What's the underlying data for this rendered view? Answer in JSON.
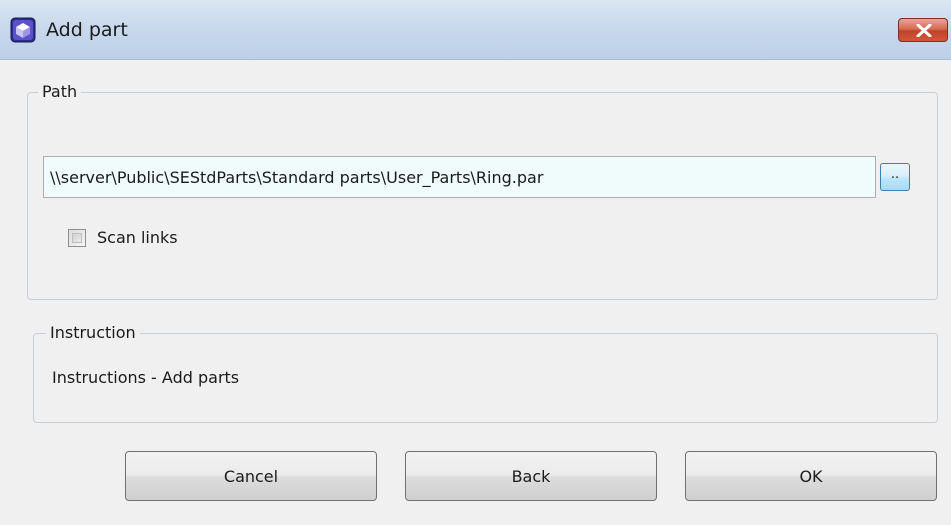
{
  "window": {
    "title": "Add part",
    "app_icon": "solid-edge-app-icon",
    "close_icon": "close-icon"
  },
  "path_group": {
    "legend": "Path",
    "path_value": "\\\\server\\Public\\SEStdParts\\Standard parts\\User_Parts\\Ring.par",
    "browse_label": "..",
    "scan_links_label": "Scan links",
    "scan_links_checked": false
  },
  "instruction_group": {
    "legend": "Instruction",
    "text": "Instructions - Add parts"
  },
  "buttons": {
    "cancel": "Cancel",
    "back": "Back",
    "ok": "OK"
  },
  "colors": {
    "titlebar": "#c9d9ec",
    "close_button": "#c1432a",
    "path_input_bg": "#f0fbfb",
    "dialog_bg": "#f0f0f0"
  }
}
